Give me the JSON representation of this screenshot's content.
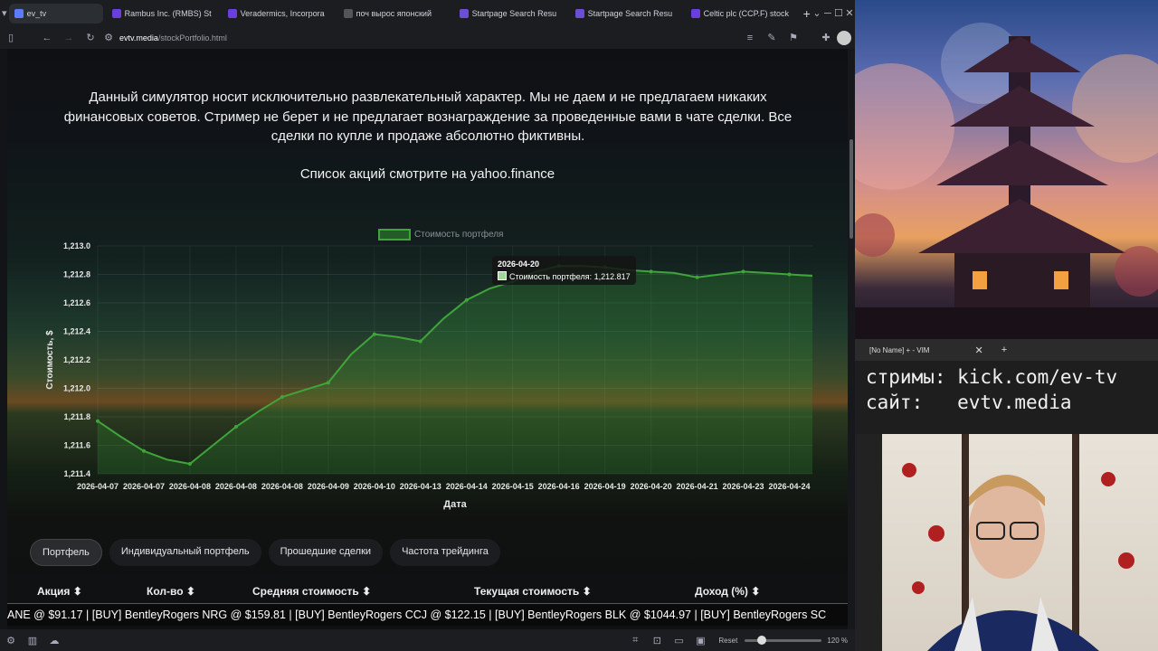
{
  "browser": {
    "tabs": [
      {
        "label": "ev_tv",
        "color": "#5b7cff",
        "active": true
      },
      {
        "label": "Rambus Inc. (RMBS) St",
        "color": "#6a3fe0"
      },
      {
        "label": "Veradermics, Incorpora",
        "color": "#6a3fe0"
      },
      {
        "label": "поч вырос японский",
        "color": "#555"
      },
      {
        "label": "Startpage Search Resu",
        "color": "#6b4dd6"
      },
      {
        "label": "Startpage Search Resu",
        "color": "#6b4dd6"
      },
      {
        "label": "Celtic plc (CCP.F) stock",
        "color": "#6a3fe0"
      }
    ],
    "new_tab": "+",
    "url_domain": "evtv.media",
    "url_path": "/stockPortfolio.html",
    "zoom": "120 %",
    "reset": "Reset"
  },
  "page": {
    "disclaimer": "Данный симулятор носит исключительно развлекательный характер. Мы не даем и не предлагаем никаких финансовых советов. Стример не берет и не предлагает вознаграждение за проведенные вами в чате сделки. Все сделки по купле и продаже абсолютно фиктивны.",
    "yahoo_note": "Список акций смотрите на yahoo.finance",
    "tooltip": {
      "date": "2026-04-20",
      "text": "Стоимость портфеля: 1,212.817"
    },
    "tabs": [
      "Портфель",
      "Индивидуальный портфель",
      "Прошедшие сделки",
      "Частота трейдинга"
    ],
    "table_headers": [
      "Акция ⬍",
      "Кол-во ⬍",
      "Средняя стоимость ⬍",
      "Текущая стоимость ⬍",
      "Доход (%) ⬍"
    ],
    "ticker": "ANE @ $91.17 | [BUY] BentleyRogers NRG @ $159.81 | [BUY] BentleyRogers CCJ @ $122.15 | [BUY] BentleyRogers BLK @ $1044.97 | [BUY] BentleyRogers SC"
  },
  "chart_data": {
    "type": "area",
    "legend": "Стоимость портфеля",
    "xlabel": "Дата",
    "ylabel": "Стоимость, $",
    "ylim": [
      1211.4,
      1213.0
    ],
    "yticks": [
      "1,211.4",
      "1,211.6",
      "1,211.8",
      "1,212.0",
      "1,212.2",
      "1,212.4",
      "1,212.6",
      "1,212.8",
      "1,213.0"
    ],
    "grid": true,
    "color": "#3fa43a",
    "categories": [
      "2026-04-07",
      "2026-04-07",
      "2026-04-08",
      "2026-04-08",
      "2026-04-08",
      "2026-04-09",
      "2026-04-10",
      "2026-04-13",
      "2026-04-14",
      "2026-04-15",
      "2026-04-16",
      "2026-04-19",
      "2026-04-20",
      "2026-04-21",
      "2026-04-23",
      "2026-04-24"
    ],
    "x": [
      0,
      0.5,
      1,
      1.5,
      2,
      2.5,
      3,
      3.5,
      4,
      4.5,
      5,
      5.5,
      6,
      6.5,
      7,
      7.5,
      8,
      8.5,
      9,
      9.5,
      10,
      10.5,
      11,
      11.5,
      12,
      12.5,
      13,
      13.5,
      14,
      14.5,
      15,
      15.5
    ],
    "values": [
      1211.77,
      1211.66,
      1211.56,
      1211.5,
      1211.47,
      1211.6,
      1211.73,
      1211.84,
      1211.94,
      1211.99,
      1212.04,
      1212.24,
      1212.38,
      1212.36,
      1212.33,
      1212.49,
      1212.62,
      1212.7,
      1212.75,
      1212.82,
      1212.86,
      1212.86,
      1212.85,
      1212.83,
      1212.82,
      1212.81,
      1212.78,
      1212.8,
      1212.82,
      1212.81,
      1212.8,
      1212.79
    ]
  },
  "vim": {
    "title": "[No Name] + - VIM",
    "line1": "стримы: kick.com/ev-tv",
    "line2": "сайт:   evtv.media"
  }
}
